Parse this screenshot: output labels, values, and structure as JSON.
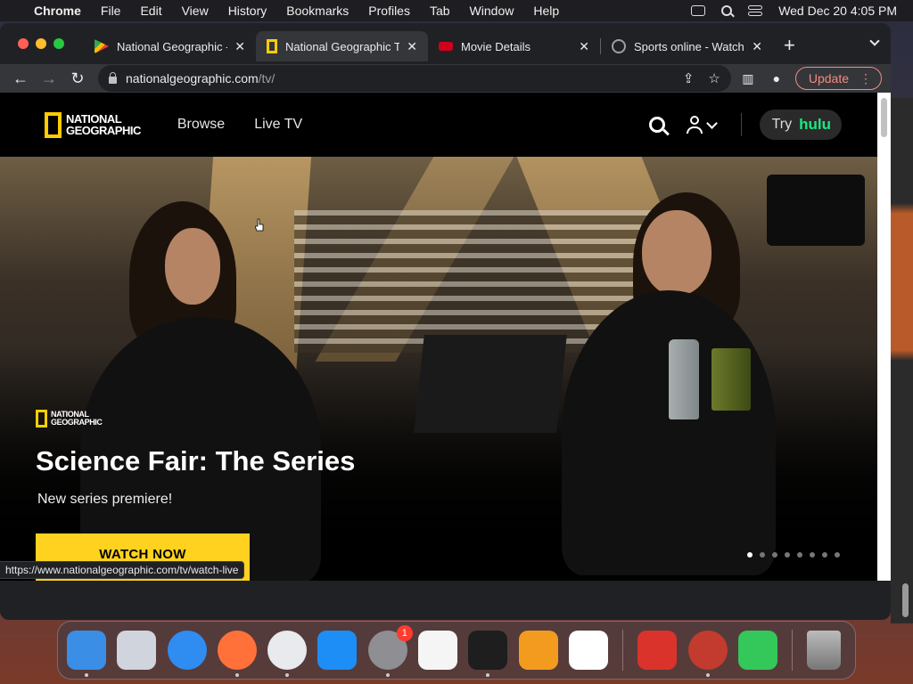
{
  "menubar": {
    "app_name": "Chrome",
    "items": [
      "File",
      "Edit",
      "View",
      "History",
      "Bookmarks",
      "Profiles",
      "Tab",
      "Window",
      "Help"
    ],
    "datetime": "Wed Dec 20  4:05 PM"
  },
  "tabs": [
    {
      "title": "National Geographic - A",
      "favicon": "google-play-icon",
      "color": "#34a853",
      "active": false
    },
    {
      "title": "National Geographic TV",
      "favicon": "natgeo-icon",
      "color": "#ffce00",
      "active": true
    },
    {
      "title": "Movie Details",
      "favicon": "amc-icon",
      "color": "#d0021b",
      "active": false
    },
    {
      "title": "Sports online - Watch l",
      "favicon": "globe-icon",
      "color": "#9aa0a6",
      "active": false
    }
  ],
  "address_bar": {
    "host": "nationalgeographic.com",
    "path": "/tv/"
  },
  "update_label": "Update",
  "site": {
    "logo_line1": "NATIONAL",
    "logo_line2": "GEOGRAPHIC",
    "nav": [
      "Browse",
      "Live TV"
    ],
    "try_label": "Try",
    "hulu_label": "hulu"
  },
  "hero": {
    "brand_line1": "NATIONAL",
    "brand_line2": "GEOGRAPHIC",
    "title": "Science Fair: The Series",
    "subtitle": "New series premiere!",
    "cta": "WATCH NOW",
    "slide_count": 8,
    "active_slide": 1
  },
  "status_url": "https://www.nationalgeographic.com/tv/watch-live",
  "colors": {
    "natgeo_yellow": "#ffce00",
    "cta_yellow": "#ffd21f",
    "hulu_green": "#1ce783",
    "update_red": "#f28b82"
  },
  "dock": [
    {
      "name": "finder-icon",
      "color": "#3a8ee6"
    },
    {
      "name": "launchpad-icon",
      "color": "#d0d4dc"
    },
    {
      "name": "safari-icon",
      "color": "#2f8cf0"
    },
    {
      "name": "firefox-icon",
      "color": "#ff7139"
    },
    {
      "name": "chrome-icon",
      "color": "#e8eaed"
    },
    {
      "name": "app-store-icon",
      "color": "#1c8ef5"
    },
    {
      "name": "system-preferences-icon",
      "color": "#8e8e93",
      "badge": "1"
    },
    {
      "name": "textedit-icon",
      "color": "#f5f5f5"
    },
    {
      "name": "terminal-icon",
      "color": "#1e1e1e"
    },
    {
      "name": "garageband-icon",
      "color": "#f29b1e"
    },
    {
      "name": "vscode-icon",
      "color": "#ffffff"
    },
    {
      "name": "photo-booth-icon",
      "color": "#d9332b"
    },
    {
      "name": "directory-utility-icon",
      "color": "#c23b2e"
    },
    {
      "name": "facetime-icon",
      "color": "#34c759"
    },
    {
      "name": "trash-icon",
      "color": "#9a9a9a"
    }
  ]
}
